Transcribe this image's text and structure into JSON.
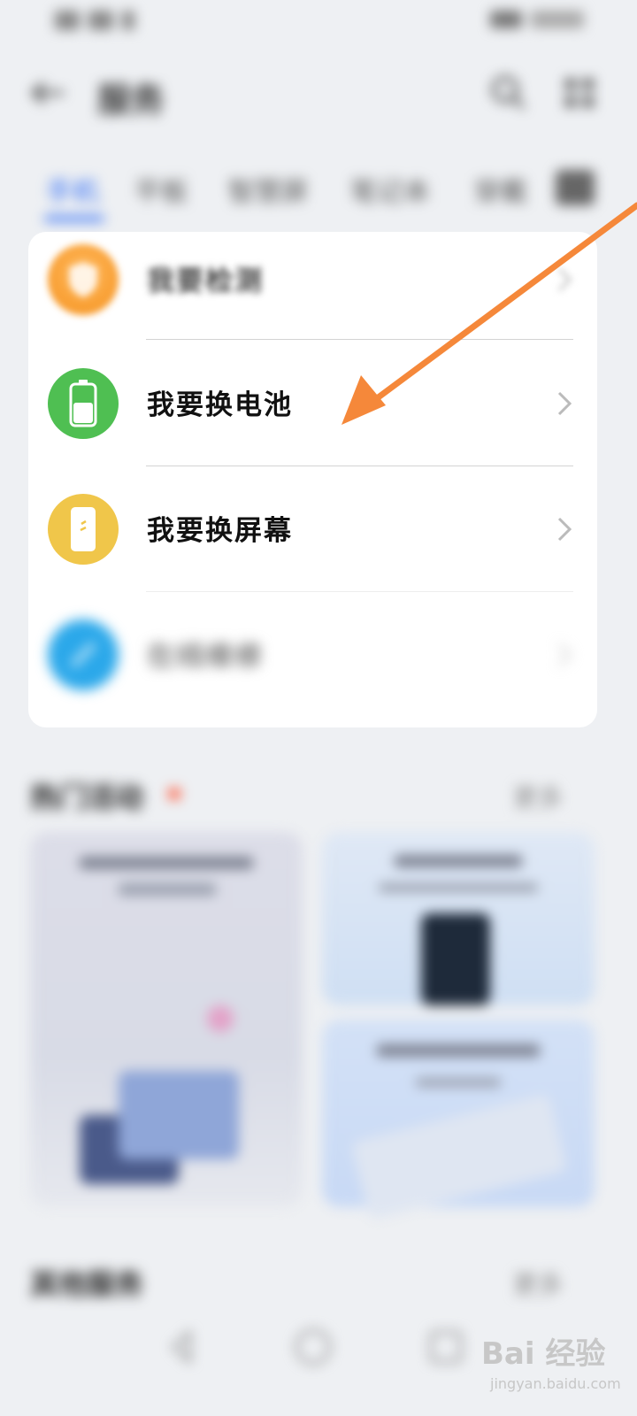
{
  "header": {
    "title": "服务"
  },
  "tabs": [
    "手机",
    "平板",
    "智慧屏",
    "笔记本",
    "穿戴"
  ],
  "list": [
    {
      "label": "我要检测",
      "icon": "shield-icon",
      "color": "#f79a2c"
    },
    {
      "label": "我要换电池",
      "icon": "battery-icon",
      "color": "#4fbf52"
    },
    {
      "label": "我要换屏幕",
      "icon": "phone-screen-icon",
      "color": "#f0c64a"
    },
    {
      "label": "在线维修",
      "icon": "wrench-icon",
      "color": "#2ba8ea"
    }
  ],
  "hot": {
    "title": "热门活动",
    "more": "更多"
  },
  "bottom_section": {
    "title": "其他服务",
    "more": "更多"
  },
  "watermark": {
    "brand": "Bai 经验",
    "url": "jingyan.baidu.com"
  },
  "colors": {
    "accent": "#2f6cf5",
    "arrow": "#f5883a"
  }
}
